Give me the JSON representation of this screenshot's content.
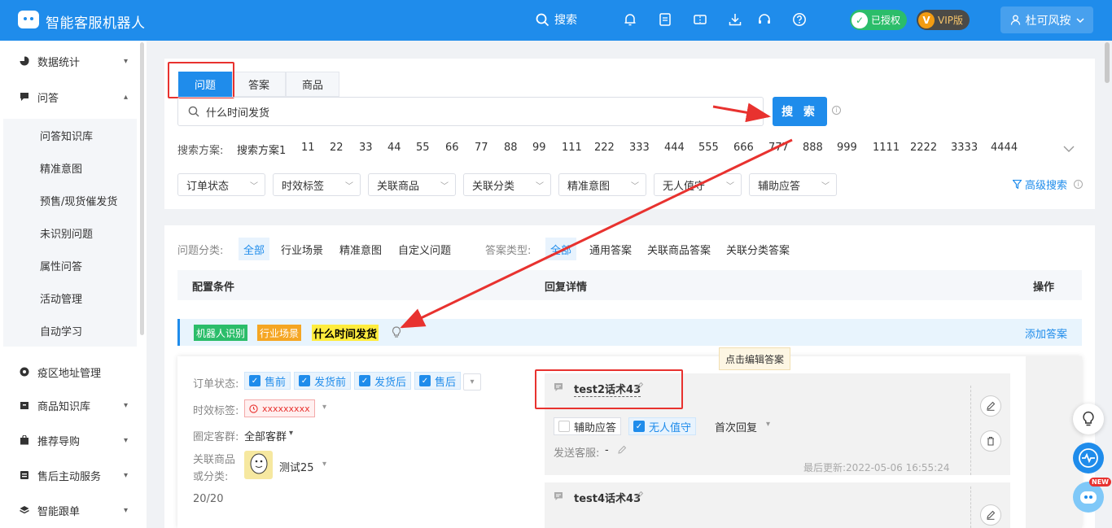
{
  "app": {
    "title": "智能客服机器人"
  },
  "topbar": {
    "search_label": "搜索",
    "auth_badge": "已授权",
    "vip_badge": "VIP版",
    "user_name": "杜可风按"
  },
  "sidebar": {
    "items": [
      {
        "label": "数据统计"
      },
      {
        "label": "问答"
      },
      {
        "label": "疫区地址管理"
      },
      {
        "label": "商品知识库"
      },
      {
        "label": "推荐导购"
      },
      {
        "label": "售后主动服务"
      },
      {
        "label": "智能跟单"
      }
    ],
    "sub_items": [
      {
        "label": "问答知识库"
      },
      {
        "label": "精准意图"
      },
      {
        "label": "预售/现货催发货"
      },
      {
        "label": "未识别问题"
      },
      {
        "label": "属性问答"
      },
      {
        "label": "活动管理"
      },
      {
        "label": "自动学习"
      }
    ]
  },
  "tabs": [
    {
      "label": "问题"
    },
    {
      "label": "答案"
    },
    {
      "label": "商品"
    }
  ],
  "search": {
    "value": "什么时间发货",
    "button_label": "搜 索"
  },
  "plans": {
    "label": "搜索方案:",
    "items": [
      "搜索方案1",
      "11",
      "22",
      "33",
      "44",
      "55",
      "66",
      "77",
      "88",
      "99",
      "111",
      "222",
      "333",
      "444",
      "555",
      "666",
      "777",
      "888",
      "999",
      "1111",
      "2222",
      "3333",
      "4444"
    ]
  },
  "filters": [
    {
      "label": "订单状态"
    },
    {
      "label": "时效标签"
    },
    {
      "label": "关联商品"
    },
    {
      "label": "关联分类"
    },
    {
      "label": "精准意图"
    },
    {
      "label": "无人值守"
    },
    {
      "label": "辅助应答"
    }
  ],
  "advanced_search": "高级搜索",
  "question_category": {
    "label": "问题分类:",
    "options": [
      "全部",
      "行业场景",
      "精准意图",
      "自定义问题"
    ]
  },
  "answer_type": {
    "label": "答案类型:",
    "options": [
      "全部",
      "通用答案",
      "关联商品答案",
      "关联分类答案"
    ]
  },
  "table_header": {
    "config": "配置条件",
    "reply": "回复详情",
    "ops": "操作"
  },
  "question_row": {
    "tag_robot": "机器人识别",
    "tag_scene": "行业场景",
    "question": "什么时间发货",
    "add_answer": "添加答案"
  },
  "tooltip": "点击编辑答案",
  "card": {
    "order_status_label": "订单状态:",
    "order_status": [
      "售前",
      "发货前",
      "发货后",
      "售后"
    ],
    "time_label": "时效标签:",
    "time_tag": "xxxxxxxxx",
    "group_label": "圈定客群:",
    "group_value": "全部客群",
    "related_label_1": "关联商品",
    "related_label_2": "或分类:",
    "related_value": "测试25",
    "count": "20/20"
  },
  "answers": [
    {
      "title": "test2话术43",
      "assist": "辅助应答",
      "unattended": "无人值守",
      "first_reply": "首次回复",
      "sender_label": "发送客服:",
      "sender_value": "-",
      "updated": "最后更新:2022-05-06 16:55:24"
    },
    {
      "title": "test4话术43"
    }
  ],
  "float_badge": "NEW",
  "colors": {
    "primary": "#1f8ceb",
    "accent_red": "#e8322f",
    "tag_green": "#2bbd6a",
    "tag_orange": "#f5a623",
    "highlight": "#ffec3d"
  }
}
